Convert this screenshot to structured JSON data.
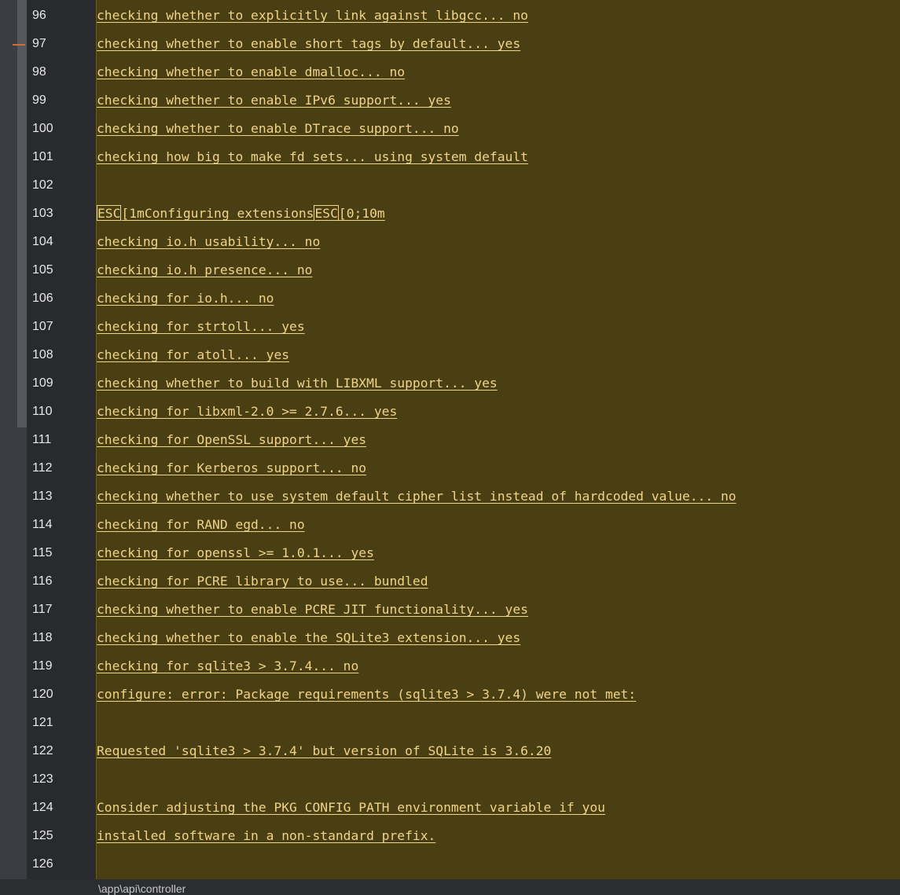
{
  "editor": {
    "lines": [
      {
        "num": "96",
        "text": "checking whether to explicitly link against libgcc... no"
      },
      {
        "num": "97",
        "text": "checking whether to enable short tags by default... yes"
      },
      {
        "num": "98",
        "text": "checking whether to enable dmalloc... no"
      },
      {
        "num": "99",
        "text": "checking whether to enable IPv6 support... yes"
      },
      {
        "num": "100",
        "text": "checking whether to enable DTrace support... no"
      },
      {
        "num": "101",
        "text": "checking how big to make fd sets... using system default"
      },
      {
        "num": "102",
        "text": ""
      },
      {
        "num": "103",
        "text": "",
        "segments": [
          {
            "text": "ESC",
            "esc": true
          },
          {
            "text": "[1mConfiguring extensions",
            "esc": false
          },
          {
            "text": "ESC",
            "esc": true
          },
          {
            "text": "[0;10m",
            "esc": false
          }
        ]
      },
      {
        "num": "104",
        "text": "checking io.h usability... no"
      },
      {
        "num": "105",
        "text": "checking io.h presence... no"
      },
      {
        "num": "106",
        "text": "checking for io.h... no"
      },
      {
        "num": "107",
        "text": "checking for strtoll... yes"
      },
      {
        "num": "108",
        "text": "checking for atoll... yes"
      },
      {
        "num": "109",
        "text": "checking whether to build with LIBXML support... yes"
      },
      {
        "num": "110",
        "text": "checking for libxml-2.0 >= 2.7.6... yes"
      },
      {
        "num": "111",
        "text": "checking for OpenSSL support... yes"
      },
      {
        "num": "112",
        "text": "checking for Kerberos support... no"
      },
      {
        "num": "113",
        "text": "checking whether to use system default cipher list instead of hardcoded value... no"
      },
      {
        "num": "114",
        "text": "checking for RAND_egd... no"
      },
      {
        "num": "115",
        "text": "checking for openssl >= 1.0.1... yes"
      },
      {
        "num": "116",
        "text": "checking for PCRE library to use... bundled"
      },
      {
        "num": "117",
        "text": "checking whether to enable PCRE JIT functionality... yes"
      },
      {
        "num": "118",
        "text": "checking whether to enable the SQLite3 extension... yes"
      },
      {
        "num": "119",
        "text": "checking for sqlite3 > 3.7.4... no"
      },
      {
        "num": "120",
        "text": "configure: error: Package requirements (sqlite3 > 3.7.4) were not met:"
      },
      {
        "num": "121",
        "text": ""
      },
      {
        "num": "122",
        "text": "Requested 'sqlite3 > 3.7.4' but version of SQLite is 3.6.20"
      },
      {
        "num": "123",
        "text": ""
      },
      {
        "num": "124",
        "text": "Consider adjusting the PKG_CONFIG_PATH environment variable if you"
      },
      {
        "num": "125",
        "text": "installed software in a non-standard prefix."
      },
      {
        "num": "126",
        "text": ""
      }
    ]
  },
  "statusbar": {
    "path": "\\app\\api\\controller"
  },
  "colors": {
    "content_bg": "#4a3e13",
    "code_text": "#efd48a",
    "gutter_bg": "#282a2e",
    "line_number": "#e8e8e8",
    "change_marker": "#d46b34"
  }
}
